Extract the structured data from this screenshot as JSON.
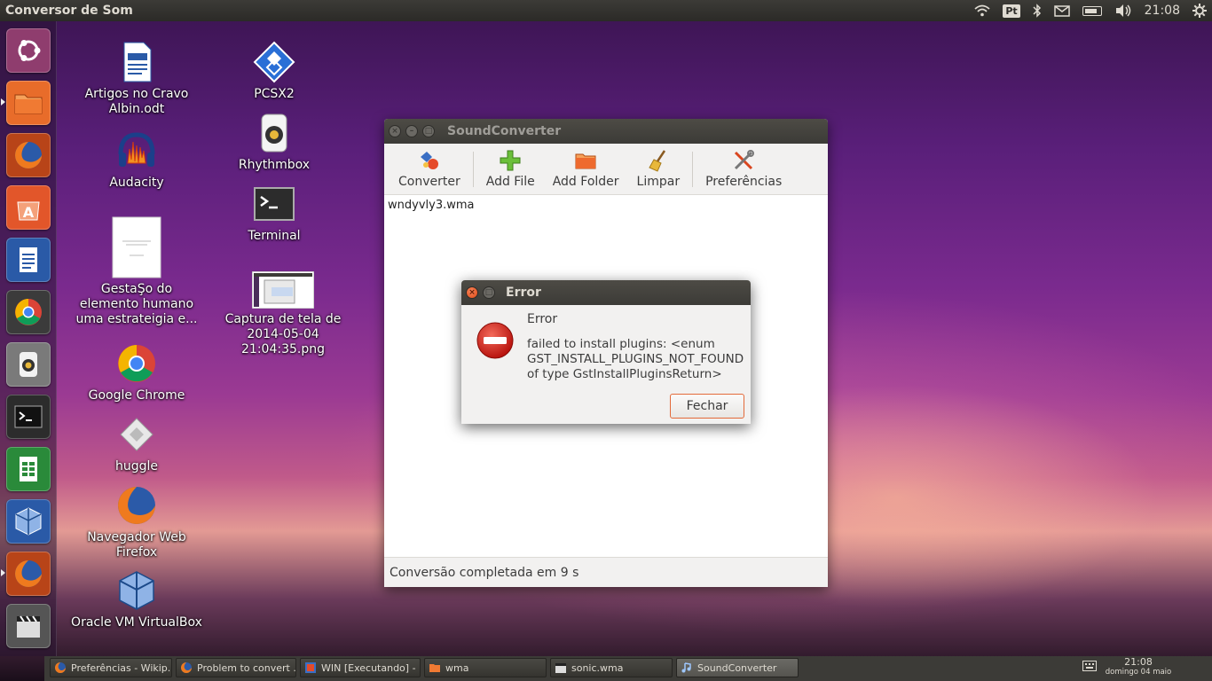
{
  "top_panel": {
    "app_title": "Conversor de Som",
    "keyboard_layout": "Pt",
    "clock": "21:08",
    "icons": [
      "wifi-icon",
      "keyboard-layout-icon",
      "bluetooth-icon",
      "mail-icon",
      "battery-icon",
      "volume-icon",
      "clock",
      "gear-icon"
    ]
  },
  "launcher": {
    "items": [
      {
        "name": "ubuntu-dash-icon",
        "color": "#8f3d6e"
      },
      {
        "name": "files-icon",
        "color": "#e86c2a"
      },
      {
        "name": "firefox-icon",
        "color": "#d9531e"
      },
      {
        "name": "software-center-icon",
        "color": "#e2562a"
      },
      {
        "name": "libreoffice-writer-icon",
        "color": "#2a5aa7"
      },
      {
        "name": "chrome-icon",
        "color": "#3b7f3b"
      },
      {
        "name": "rhythmbox-icon",
        "color": "#c9a227"
      },
      {
        "name": "terminal-icon",
        "color": "#2c2c2c"
      },
      {
        "name": "libreoffice-calc-icon",
        "color": "#2a8a3a"
      },
      {
        "name": "virtualbox-icon",
        "color": "#2a5aa7"
      },
      {
        "name": "firefox-icon-2",
        "color": "#d9531e"
      },
      {
        "name": "clapperboard-icon",
        "color": "#555555"
      }
    ]
  },
  "desktop_icons": [
    {
      "label": "Artigos no Cravo Albin.odt",
      "icon": "document-icon"
    },
    {
      "label": "Audacity",
      "icon": "audacity-icon"
    },
    {
      "label": "GestaŞo do elemento humano uma estrateigia e...",
      "icon": "pdf-page-icon"
    },
    {
      "label": "Google Chrome",
      "icon": "chrome-icon"
    },
    {
      "label": "huggle",
      "icon": "huggle-icon"
    },
    {
      "label": "Navegador Web Firefox",
      "icon": "firefox-icon"
    },
    {
      "label": "Oracle VM VirtualBox",
      "icon": "virtualbox-icon"
    },
    {
      "label": "PCSX2",
      "icon": "pcsx2-icon"
    },
    {
      "label": "Rhythmbox",
      "icon": "rhythmbox-icon"
    },
    {
      "label": "Terminal",
      "icon": "terminal-icon"
    },
    {
      "label": "Captura de tela de 2014-05-04 21:04:35.png",
      "icon": "screenshot-thumbnail-icon"
    }
  ],
  "soundconverter": {
    "title": "SoundConverter",
    "toolbar": {
      "convert": "Converter",
      "add_file": "Add File",
      "add_folder": "Add Folder",
      "clear": "Limpar",
      "preferences": "Preferências"
    },
    "files": [
      "wndyvly3.wma"
    ],
    "status": "Conversão completada em 9 s"
  },
  "error_dialog": {
    "title": "Error",
    "heading": "Error",
    "message": "failed to install plugins: <enum GST_INSTALL_PLUGINS_NOT_FOUND of type GstInstallPluginsReturn>",
    "close_label": "Fechar",
    "accent": "#e36a3a"
  },
  "taskbar": {
    "tasks": [
      {
        "label": "Preferências - Wikip...",
        "icon": "firefox-icon",
        "active": false
      },
      {
        "label": "Problem to convert ...",
        "icon": "firefox-icon",
        "active": false
      },
      {
        "label": "WIN [Executando] - ...",
        "icon": "virtualbox-icon",
        "active": false
      },
      {
        "label": "wma",
        "icon": "folder-icon",
        "active": false
      },
      {
        "label": "sonic.wma",
        "icon": "clapperboard-icon",
        "active": false
      },
      {
        "label": "SoundConverter",
        "icon": "music-note-icon",
        "active": true
      }
    ],
    "clock_time": "21:08",
    "clock_date": "domingo 04 maio"
  }
}
